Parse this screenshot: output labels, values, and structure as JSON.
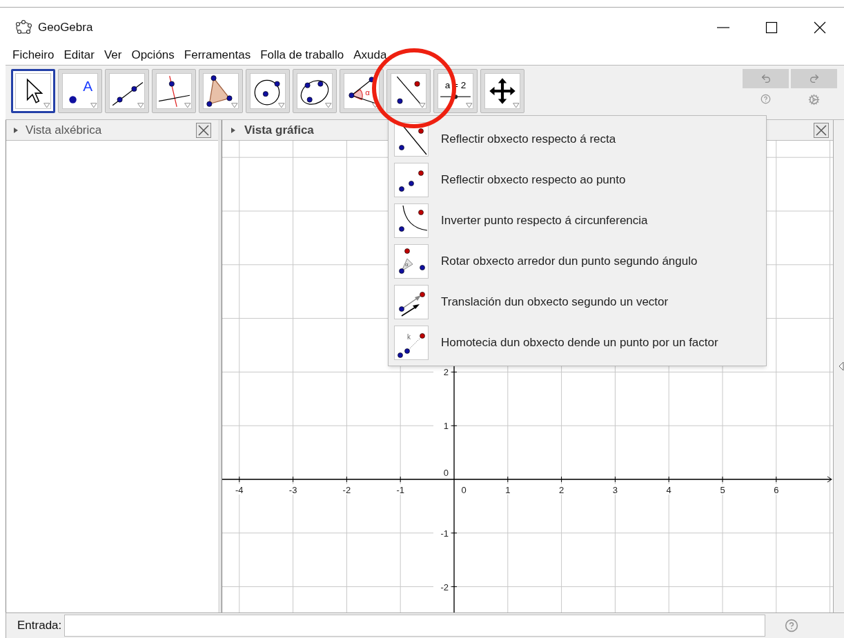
{
  "window": {
    "title": "GeoGebra"
  },
  "menu_bar": [
    "Ficheiro",
    "Editar",
    "Ver",
    "Opcións",
    "Ferramentas",
    "Folla de traballo",
    "Axuda"
  ],
  "toolbar": {
    "tools": [
      {
        "kind": "move",
        "selected": true
      },
      {
        "kind": "point",
        "text": "A",
        "selected": false
      },
      {
        "kind": "line",
        "selected": false
      },
      {
        "kind": "perpendicular",
        "selected": false
      },
      {
        "kind": "polygon",
        "selected": false
      },
      {
        "kind": "circle",
        "selected": false
      },
      {
        "kind": "conic",
        "selected": false
      },
      {
        "kind": "angle",
        "text": "α",
        "selected": false
      },
      {
        "kind": "reflect",
        "selected": false
      },
      {
        "kind": "slider",
        "text": "a = 2",
        "selected": false
      },
      {
        "kind": "move_view",
        "selected": false
      }
    ]
  },
  "algebra_view": {
    "title": "Vista alxébrica"
  },
  "graphics_view": {
    "title": "Vista gráfica",
    "x_labels": [
      {
        "text": "-4",
        "kind": "tick"
      },
      {
        "text": "-3",
        "kind": "tick"
      },
      {
        "text": "-2",
        "kind": "tick"
      },
      {
        "text": "-1",
        "kind": "tick"
      },
      {
        "text": "0",
        "kind": "origin"
      },
      {
        "text": "1",
        "kind": "tick"
      },
      {
        "text": "2",
        "kind": "tick"
      },
      {
        "text": "3",
        "kind": "tick"
      },
      {
        "text": "4",
        "kind": "tick"
      },
      {
        "text": "5",
        "kind": "tick"
      },
      {
        "text": "6",
        "kind": "tick"
      }
    ],
    "y_labels": [
      {
        "text": "2",
        "kind": "tick"
      },
      {
        "text": "1",
        "kind": "tick"
      },
      {
        "text": "0",
        "kind": "origin"
      },
      {
        "text": "-1",
        "kind": "tick"
      },
      {
        "text": "-2",
        "kind": "tick"
      }
    ]
  },
  "tool_menu": {
    "items": [
      {
        "kind": "reflect_line",
        "label": "Reflectir obxecto respecto á recta"
      },
      {
        "kind": "reflect_point",
        "label": "Reflectir obxecto respecto ao punto"
      },
      {
        "kind": "invert",
        "label": "Inverter punto respecto á circunferencia"
      },
      {
        "kind": "rotate",
        "icon_text": "α",
        "label": "Rotar obxecto arredor dun punto segundo ángulo"
      },
      {
        "kind": "translate",
        "label": "Translación dun obxecto segundo un vector"
      },
      {
        "kind": "dilate",
        "icon_text": "k",
        "label": "Homotecia dun obxecto dende un punto por un factor"
      }
    ]
  },
  "input_bar": {
    "label": "Entrada:"
  }
}
